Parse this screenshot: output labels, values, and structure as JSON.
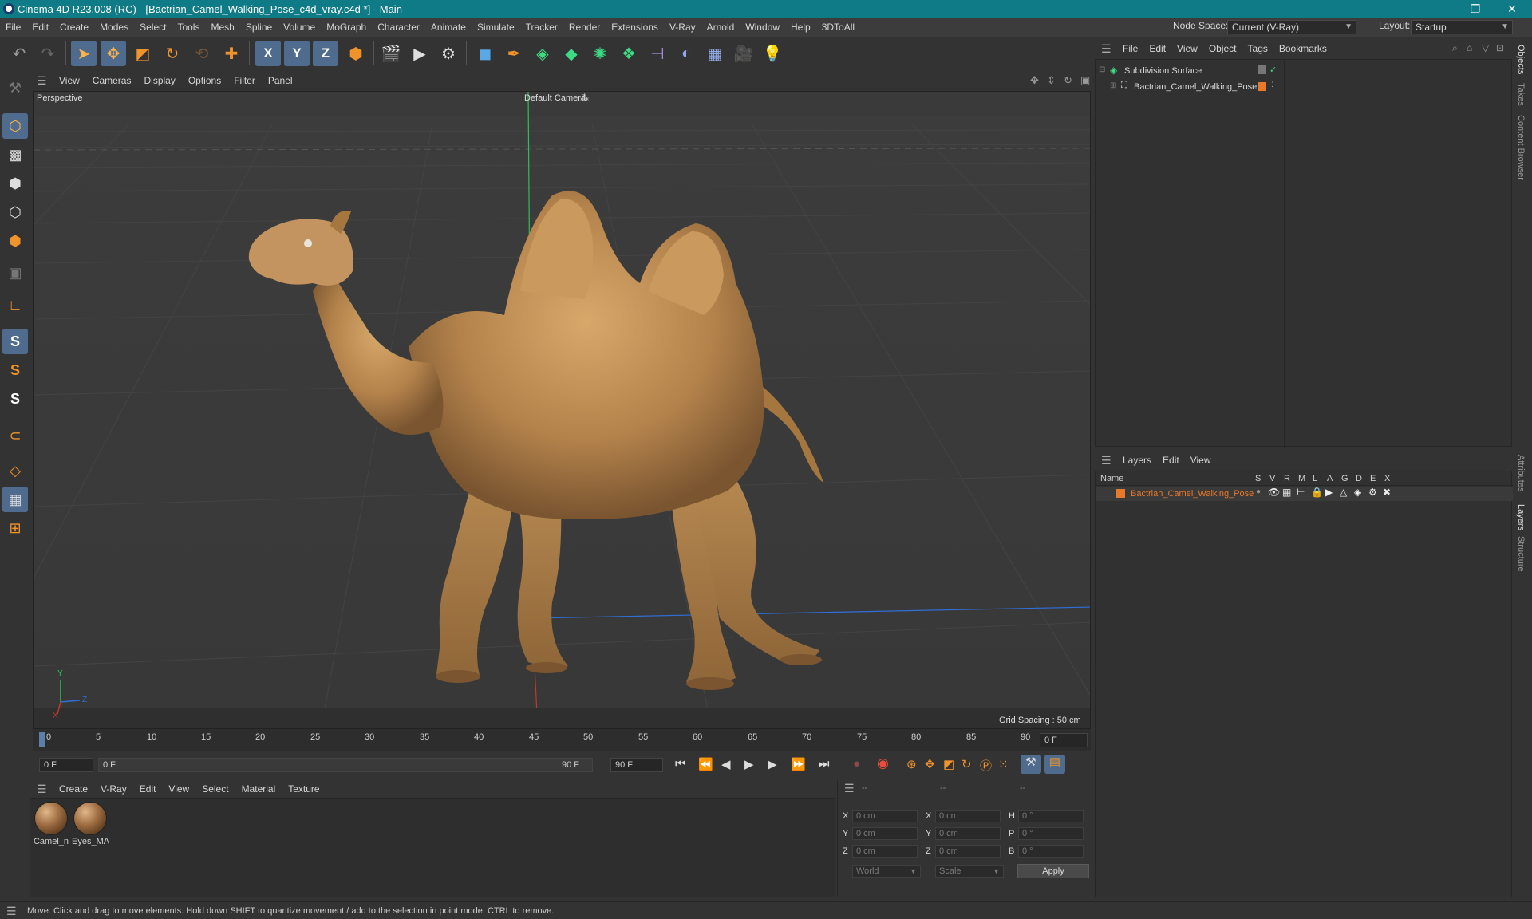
{
  "window": {
    "title": "Cinema 4D R23.008 (RC) - [Bactrian_Camel_Walking_Pose_c4d_vray.c4d *] - Main",
    "minimize": "—",
    "maximize": "❐",
    "close": "✕"
  },
  "menubar": {
    "items": [
      "File",
      "Edit",
      "Create",
      "Modes",
      "Select",
      "Tools",
      "Mesh",
      "Spline",
      "Volume",
      "MoGraph",
      "Character",
      "Animate",
      "Simulate",
      "Tracker",
      "Render",
      "Extensions",
      "V-Ray",
      "Arnold",
      "Window",
      "Help",
      "3DToAll"
    ],
    "node_space_label": "Node Space:",
    "node_space_value": "Current (V-Ray)",
    "layout_label": "Layout:",
    "layout_value": "Startup"
  },
  "toolbar": {
    "x": "X",
    "y": "Y",
    "z": "Z"
  },
  "left_tools": {
    "s1": "S",
    "s2": "S",
    "s3": "S"
  },
  "viewport": {
    "menu": [
      "View",
      "Cameras",
      "Display",
      "Options",
      "Filter",
      "Panel"
    ],
    "view_name": "Perspective",
    "camera": "Default Camera",
    "grid_spacing": "Grid Spacing : 50 cm",
    "axis_y": "Y",
    "axis_z": "Z",
    "axis_x": "X",
    "colors": {
      "y_axis": "#2fbf5a",
      "x_axis": "#c0392b",
      "z_axis": "#2f6fd6"
    }
  },
  "timeline": {
    "ticks": [
      "0",
      "5",
      "10",
      "15",
      "20",
      "25",
      "30",
      "35",
      "40",
      "45",
      "50",
      "55",
      "60",
      "65",
      "70",
      "75",
      "80",
      "85",
      "90"
    ],
    "current_frame": "0 F"
  },
  "transport": {
    "start": "0 F",
    "range_start": "0 F",
    "range_end": "90 F",
    "end": "90 F"
  },
  "materials": {
    "menu": [
      "Create",
      "V-Ray",
      "Edit",
      "View",
      "Select",
      "Material",
      "Texture"
    ],
    "items": [
      {
        "name": "Camel_n"
      },
      {
        "name": "Eyes_MA"
      }
    ]
  },
  "coordinates": {
    "headers": [
      "--",
      "--",
      "--"
    ],
    "rows": [
      {
        "a": "X",
        "av": "0 cm",
        "b": "X",
        "bv": "0 cm",
        "c": "H",
        "cv": "0 °"
      },
      {
        "a": "Y",
        "av": "0 cm",
        "b": "Y",
        "bv": "0 cm",
        "c": "P",
        "cv": "0 °"
      },
      {
        "a": "Z",
        "av": "0 cm",
        "b": "Z",
        "bv": "0 cm",
        "c": "B",
        "cv": "0 °"
      }
    ],
    "mode1": "World",
    "mode2": "Scale",
    "apply": "Apply"
  },
  "object_manager": {
    "menu": [
      "File",
      "Edit",
      "View",
      "Object",
      "Tags",
      "Bookmarks"
    ],
    "objects": [
      {
        "name": "Subdivision Surface"
      },
      {
        "name": "Bactrian_Camel_Walking_Pose"
      }
    ]
  },
  "layer_manager": {
    "menu": [
      "Layers",
      "Edit",
      "View"
    ],
    "col_name": "Name",
    "columns": [
      "S",
      "V",
      "R",
      "M",
      "L",
      "A",
      "G",
      "D",
      "E",
      "X"
    ],
    "layers": [
      {
        "name": "Bactrian_Camel_Walking_Pose",
        "color": "#e8782a"
      }
    ]
  },
  "side_tabs": [
    "Objects",
    "Takes",
    "Content Browser",
    "Attributes",
    "Layers",
    "Structure"
  ],
  "status": "Move: Click and drag to move elements. Hold down SHIFT to quantize movement / add to the selection in point mode, CTRL to remove."
}
